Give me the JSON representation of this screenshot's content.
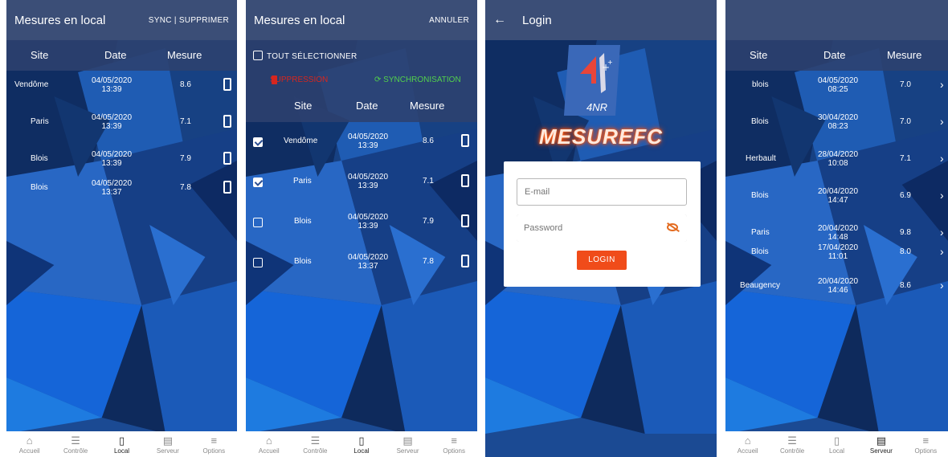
{
  "screens": {
    "local": {
      "title": "Mesures en local",
      "action": "SYNC | SUPPRIMER",
      "columns": [
        "Site",
        "Date",
        "Mesure"
      ],
      "rows": [
        {
          "site": "Vendôme",
          "date": "04/05/2020",
          "time": "13:39",
          "value": "8.6"
        },
        {
          "site": "Paris",
          "date": "04/05/2020",
          "time": "13:39",
          "value": "7.1"
        },
        {
          "site": "Blois",
          "date": "04/05/2020",
          "time": "13:39",
          "value": "7.9"
        },
        {
          "site": "Blois",
          "date": "04/05/2020",
          "time": "13:37",
          "value": "7.8"
        }
      ]
    },
    "select": {
      "title": "Mesures en local",
      "action": "ANNULER",
      "select_all": "TOUT SÉLECTIONNER",
      "delete": "SUPPRESSION",
      "sync": "SYNCHRONISATION",
      "columns": [
        "Site",
        "Date",
        "Mesure"
      ],
      "rows": [
        {
          "site": "Vendôme",
          "date": "04/05/2020",
          "time": "13:39",
          "value": "8.6",
          "checked": true
        },
        {
          "site": "Paris",
          "date": "04/05/2020",
          "time": "13:39",
          "value": "7.1",
          "checked": true
        },
        {
          "site": "Blois",
          "date": "04/05/2020",
          "time": "13:39",
          "value": "7.9",
          "checked": false
        },
        {
          "site": "Blois",
          "date": "04/05/2020",
          "time": "13:37",
          "value": "7.8",
          "checked": false
        }
      ]
    },
    "login": {
      "title": "Login",
      "logo_text": "4NR",
      "brand": "MESUREFC",
      "email_placeholder": "E-mail",
      "password_placeholder": "Password",
      "login_button": "LOGIN"
    },
    "server": {
      "columns": [
        "Site",
        "Date",
        "Mesure"
      ],
      "rows": [
        {
          "site": "blois",
          "date": "04/05/2020",
          "time": "08:25",
          "value": "7.0"
        },
        {
          "site": "Blois",
          "date": "30/04/2020",
          "time": "08:23",
          "value": "7.0"
        },
        {
          "site": "Herbault",
          "date": "28/04/2020",
          "time": "10:08",
          "value": "7.1"
        },
        {
          "site": "Blois",
          "date": "20/04/2020",
          "time": "14:47",
          "value": "6.9"
        },
        {
          "site": "Paris",
          "date": "20/04/2020",
          "time": "14:48",
          "value": "9.8"
        },
        {
          "site": "Blois",
          "date": "17/04/2020",
          "time": "11:01",
          "value": "8.0"
        },
        {
          "site": "Beaugency",
          "date": "20/04/2020",
          "time": "14:46",
          "value": "8.6"
        }
      ]
    }
  },
  "nav": [
    "Accueil",
    "Contrôle",
    "Local",
    "Serveur",
    "Options"
  ],
  "nav_icons": [
    "home-icon",
    "checklist-icon",
    "phone-icon",
    "server-icon",
    "menu-icon"
  ],
  "colors": {
    "app_bar": "#3b4e77",
    "background": "#123a7a",
    "delete": "#d7261e",
    "sync": "#52d04c",
    "login_button": "#f04c1a"
  }
}
